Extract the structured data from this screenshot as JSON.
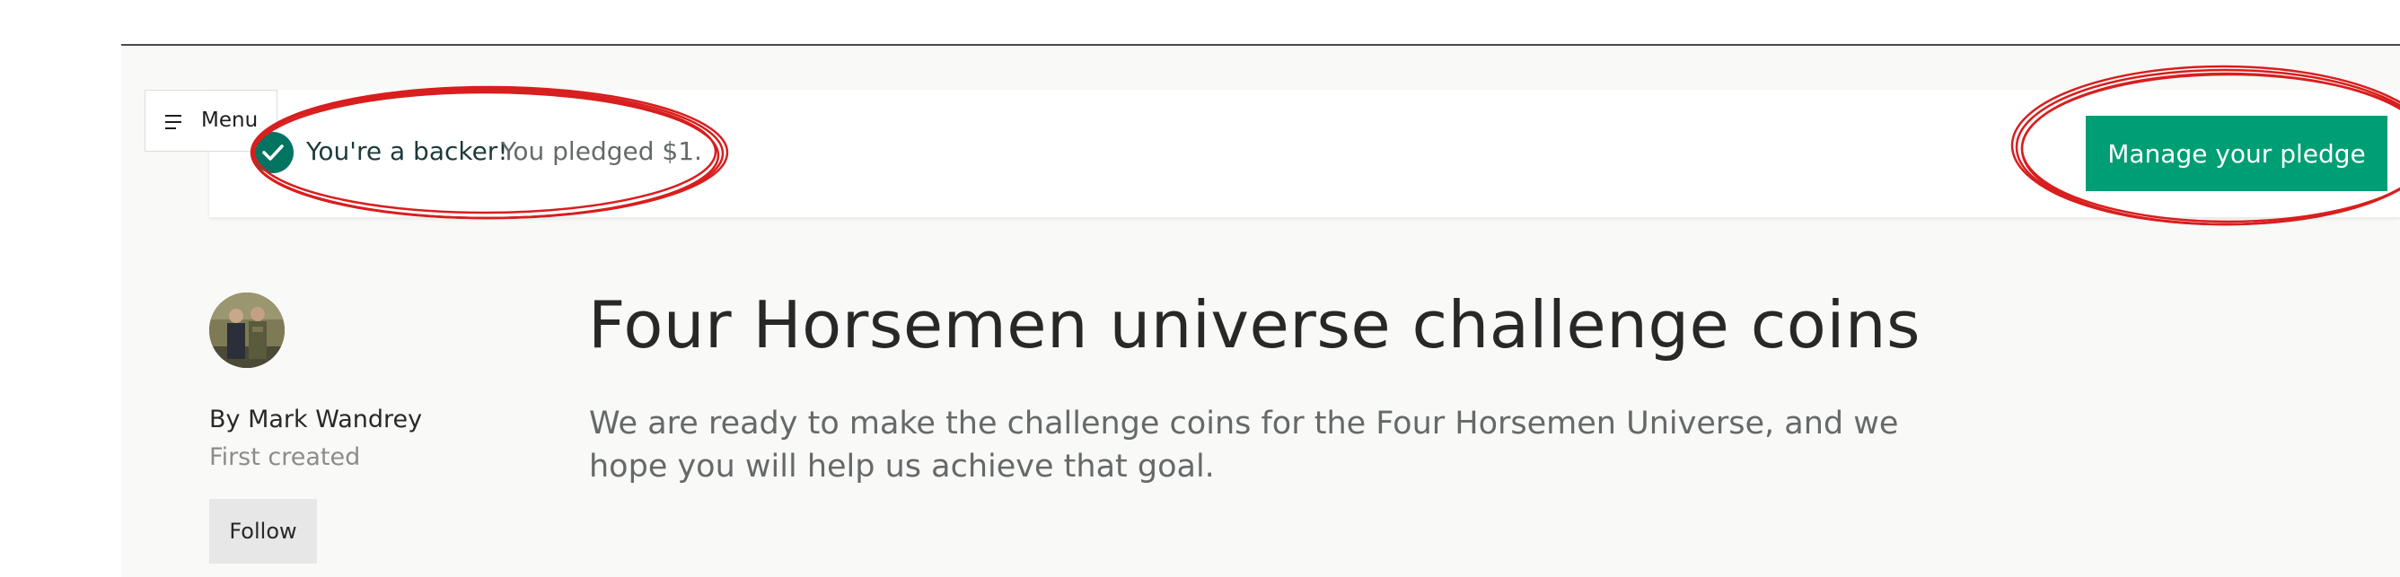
{
  "menu": {
    "label": "Menu",
    "icon": "hamburger-icon"
  },
  "banner": {
    "status_icon": "check-circle-icon",
    "backer_label": "You're a backer!",
    "pledge_label": "You pledged $1.",
    "manage_button_label": "Manage your pledge",
    "accent_color": "#009e74"
  },
  "creator": {
    "avatar_icon": "creator-avatar",
    "name": "By Mark Wandrey",
    "first_created": "First created",
    "follow_label": "Follow"
  },
  "project": {
    "title": "Four Horsemen universe challenge coins",
    "blurb": "We are ready to make the challenge coins for the Four Horsemen Universe, and we hope you will help us achieve that goal."
  }
}
